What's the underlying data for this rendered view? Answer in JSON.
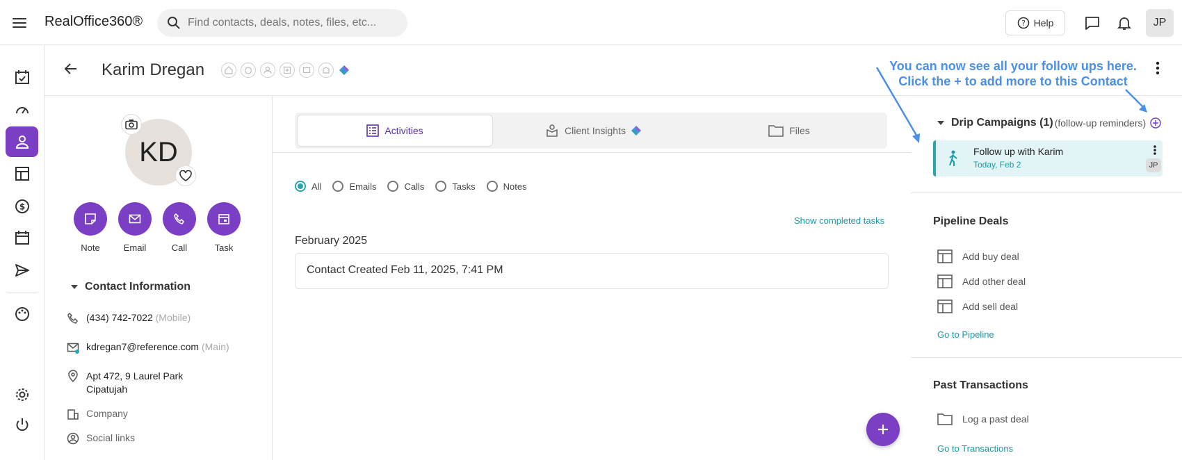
{
  "app": {
    "brand": "RealOffice360®"
  },
  "search": {
    "placeholder": "Find contacts, deals, notes, files, etc..."
  },
  "topbar": {
    "help_label": "Help",
    "user_initials": "JP"
  },
  "contact": {
    "name": "Karim Dregan",
    "initials": "KD",
    "actions": [
      "Note",
      "Email",
      "Call",
      "Task"
    ],
    "info_title": "Contact Information",
    "phone": "(434) 742-7022",
    "phone_type": "(Mobile)",
    "email": "kdregan7@reference.com",
    "email_type": "(Main)",
    "address_line1": "Apt 472, 9 Laurel Park",
    "address_line2": "Cipatujah",
    "company": "Company",
    "social": "Social links"
  },
  "promo": {
    "line1": "You can now see all your follow ups here.",
    "line2": "Click the + to add more to this Contact"
  },
  "tabs": [
    "Activities",
    "Client Insights",
    "Files"
  ],
  "filters": [
    "All",
    "Emails",
    "Calls",
    "Tasks",
    "Notes"
  ],
  "activity": {
    "show_completed": "Show completed tasks",
    "month": "February 2025",
    "entry": "Contact Created Feb 11, 2025, 7:41 PM"
  },
  "drip": {
    "title": "Drip Campaigns (1)",
    "subtitle": "(follow-up reminders)",
    "card_title": "Follow up with Karim",
    "card_date": "Today, Feb 2",
    "card_user": "JP"
  },
  "pipeline": {
    "title": "Pipeline Deals",
    "items": [
      "Add buy deal",
      "Add other deal",
      "Add sell deal"
    ],
    "link": "Go to Pipeline"
  },
  "past": {
    "title": "Past Transactions",
    "item": "Log a past deal",
    "link": "Go to Transactions"
  },
  "colors": {
    "accent": "#7b3fc6",
    "teal": "#2aa4ad",
    "promo": "#4b8fe8"
  }
}
